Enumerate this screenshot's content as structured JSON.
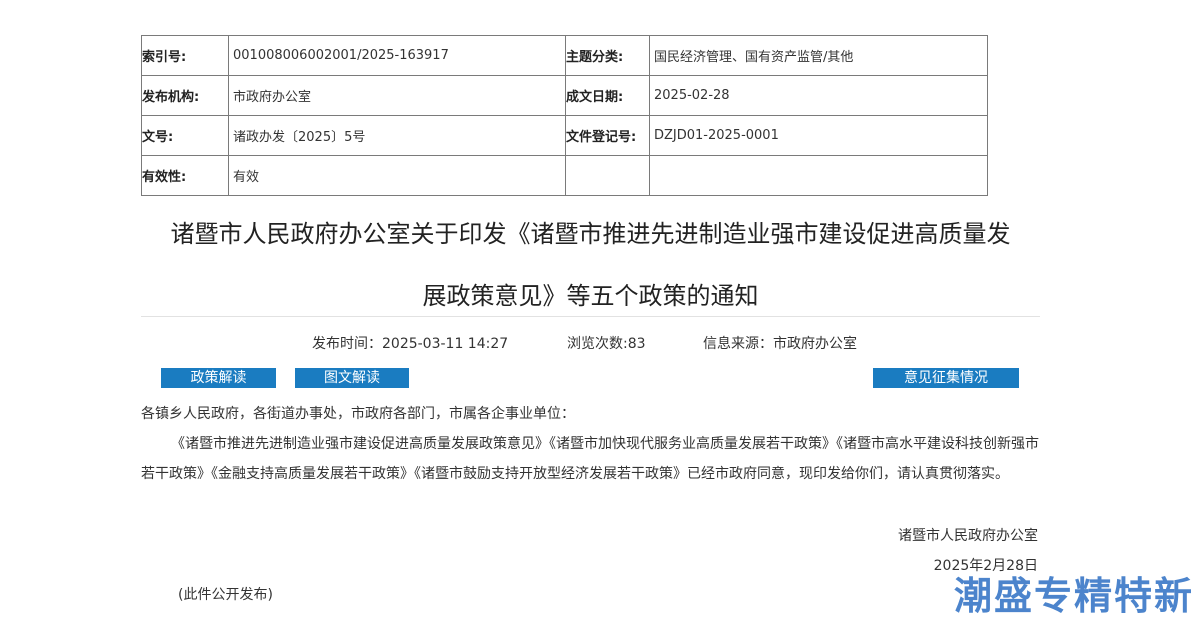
{
  "meta": {
    "index_no_label": "索引号:",
    "index_no": "001008006002001/2025-163917",
    "topic_label": "主题分类:",
    "topic": "国民经济管理、国有资产监管/其他",
    "issuer_label": "发布机构:",
    "issuer": "市政府办公室",
    "date_label": "成文日期:",
    "date": "2025-02-28",
    "doc_no_label": "文号:",
    "doc_no": "诸政办发〔2025〕5号",
    "reg_no_label": "文件登记号:",
    "reg_no": "DZJD01-2025-0001",
    "validity_label": "有效性:",
    "validity": "有效"
  },
  "title_line1": "诸暨市人民政府办公室关于印发《诸暨市推进先进制造业强市建设促进高质量发",
  "title_line2": "展政策意见》等五个政策的通知",
  "info": {
    "publish_time": "发布时间：2025-03-11 14:27",
    "views": "浏览次数:83",
    "source": "信息来源：市政府办公室"
  },
  "buttons": {
    "policy_interpretation": "政策解读",
    "graphic_interpretation": "图文解读",
    "feedback": "意见征集情况"
  },
  "body": {
    "salutation": "各镇乡人民政府，各街道办事处，市政府各部门，市属各企事业单位：",
    "paragraph": "《诸暨市推进先进制造业强市建设促进高质量发展政策意见》《诸暨市加快现代服务业高质量发展若干政策》《诸暨市高水平建设科技创新强市若干政策》《金融支持高质量发展若干政策》《诸暨市鼓励支持开放型经济发展若干政策》已经市政府同意，现印发给你们，请认真贯彻落实。",
    "signature": "诸暨市人民政府办公室",
    "sign_date": "2025年2月28日",
    "note": "(此件公开发布)"
  },
  "watermark": "潮盛专精特新",
  "colors": {
    "button_bg": "#1a7cc1",
    "watermark": "#2d6fc4"
  }
}
